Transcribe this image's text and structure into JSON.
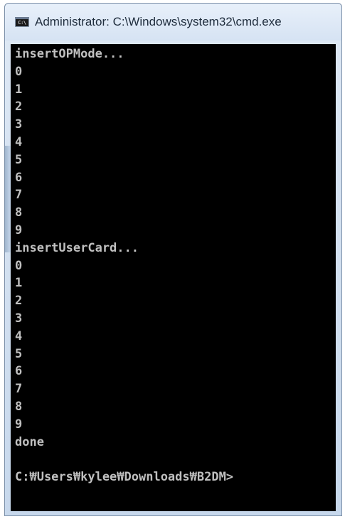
{
  "window": {
    "title": "Administrator: C:\\Windows\\system32\\cmd.exe",
    "icon_label": "C:\\"
  },
  "console": {
    "lines": [
      "insertOPMode...",
      "0",
      "1",
      "2",
      "3",
      "4",
      "5",
      "6",
      "7",
      "8",
      "9",
      "insertUserCard...",
      "0",
      "1",
      "2",
      "3",
      "4",
      "5",
      "6",
      "7",
      "8",
      "9",
      "done"
    ],
    "prompt": "C:₩Users₩kylee₩Downloads₩B2DM>"
  },
  "colors": {
    "console_background": "#000000",
    "console_text": "#c0c0c0",
    "titlebar": "#d6e3f3"
  }
}
